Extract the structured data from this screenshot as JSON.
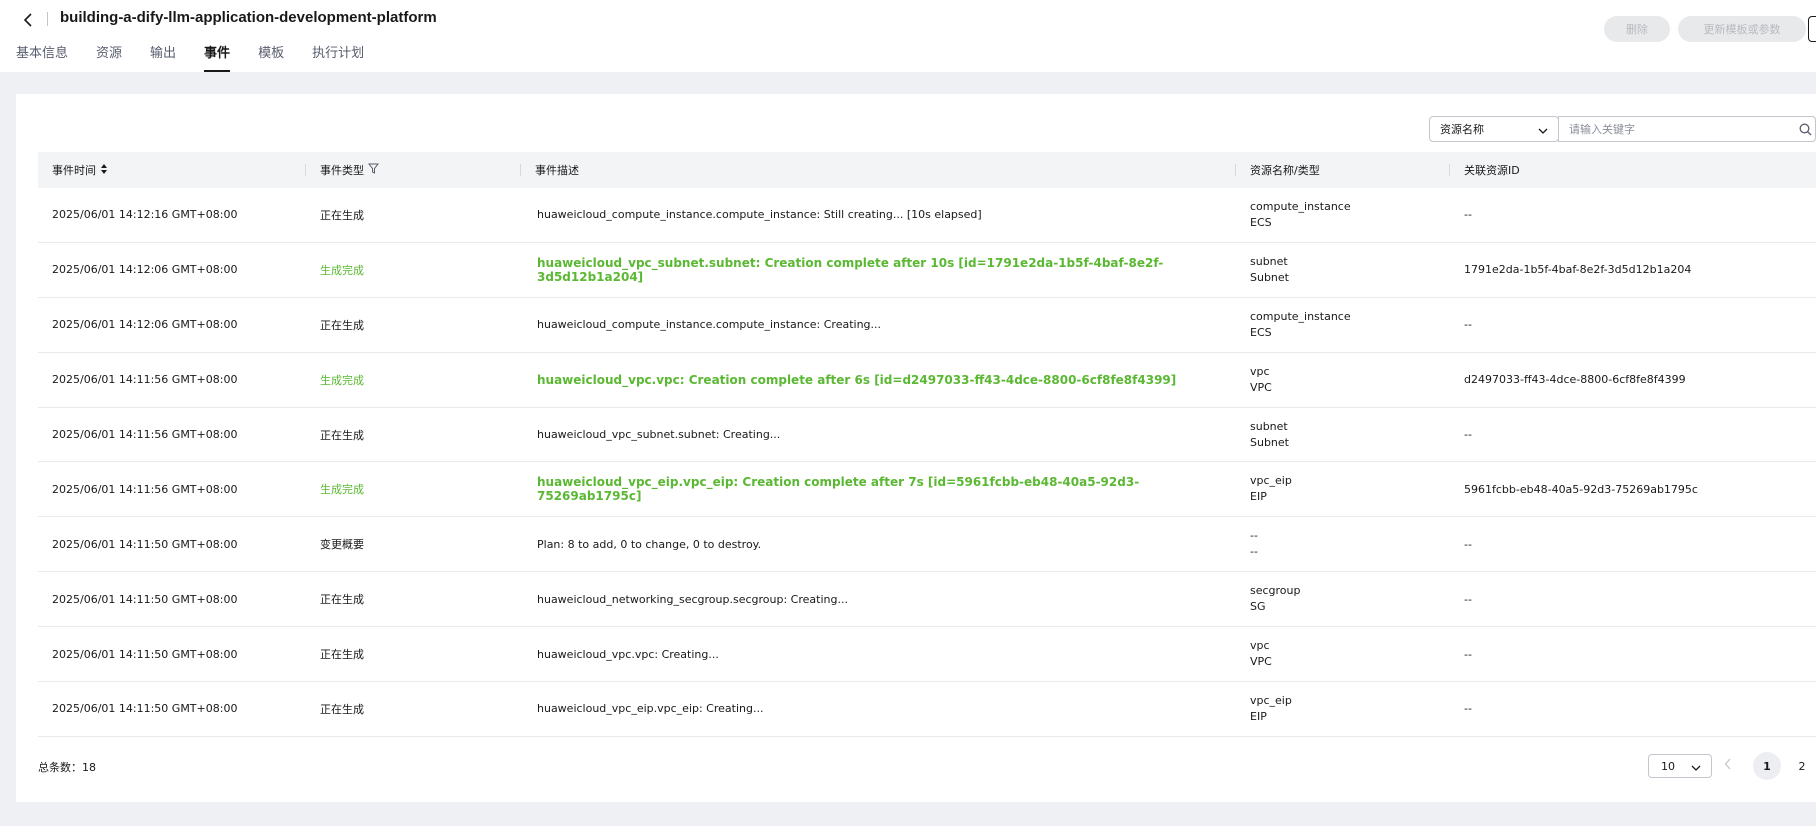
{
  "header": {
    "title": "building-a-dify-llm-application-development-platform",
    "delete_label": "删除",
    "update_label": "更新模板或参数"
  },
  "tabs": [
    {
      "label": "基本信息"
    },
    {
      "label": "资源"
    },
    {
      "label": "输出"
    },
    {
      "label": "事件"
    },
    {
      "label": "模板"
    },
    {
      "label": "执行计划"
    }
  ],
  "filter": {
    "select_value": "资源名称",
    "search_placeholder": "请输入关键字"
  },
  "table": {
    "headers": [
      "事件时间",
      "事件类型",
      "事件描述",
      "资源名称/类型",
      "关联资源ID"
    ],
    "rows": [
      {
        "time": "2025/06/01 14:12:16 GMT+08:00",
        "type": "正在生成",
        "desc": "huaweicloud_compute_instance.compute_instance: Still creating... [10s elapsed]",
        "res_name": "compute_instance",
        "res_type": "ECS",
        "res_id": "--",
        "status": "creating"
      },
      {
        "time": "2025/06/01 14:12:06 GMT+08:00",
        "type": "生成完成",
        "desc": "huaweicloud_vpc_subnet.subnet: Creation complete after 10s [id=1791e2da-1b5f-4baf-8e2f-3d5d12b1a204]",
        "res_name": "subnet",
        "res_type": "Subnet",
        "res_id": "1791e2da-1b5f-4baf-8e2f-3d5d12b1a204",
        "status": "success"
      },
      {
        "time": "2025/06/01 14:12:06 GMT+08:00",
        "type": "正在生成",
        "desc": "huaweicloud_compute_instance.compute_instance: Creating...",
        "res_name": "compute_instance",
        "res_type": "ECS",
        "res_id": "--",
        "status": "creating"
      },
      {
        "time": "2025/06/01 14:11:56 GMT+08:00",
        "type": "生成完成",
        "desc": "huaweicloud_vpc.vpc: Creation complete after 6s [id=d2497033-ff43-4dce-8800-6cf8fe8f4399]",
        "res_name": "vpc",
        "res_type": "VPC",
        "res_id": "d2497033-ff43-4dce-8800-6cf8fe8f4399",
        "status": "success"
      },
      {
        "time": "2025/06/01 14:11:56 GMT+08:00",
        "type": "正在生成",
        "desc": "huaweicloud_vpc_subnet.subnet: Creating...",
        "res_name": "subnet",
        "res_type": "Subnet",
        "res_id": "--",
        "status": "creating"
      },
      {
        "time": "2025/06/01 14:11:56 GMT+08:00",
        "type": "生成完成",
        "desc": "huaweicloud_vpc_eip.vpc_eip: Creation complete after 7s [id=5961fcbb-eb48-40a5-92d3-75269ab1795c]",
        "res_name": "vpc_eip",
        "res_type": "EIP",
        "res_id": "5961fcbb-eb48-40a5-92d3-75269ab1795c",
        "status": "success"
      },
      {
        "time": "2025/06/01 14:11:50 GMT+08:00",
        "type": "变更概要",
        "desc": "Plan: 8 to add, 0 to change, 0 to destroy.",
        "res_name": "--",
        "res_type": "--",
        "res_id": "--",
        "status": "plan"
      },
      {
        "time": "2025/06/01 14:11:50 GMT+08:00",
        "type": "正在生成",
        "desc": "huaweicloud_networking_secgroup.secgroup: Creating...",
        "res_name": "secgroup",
        "res_type": "SG",
        "res_id": "--",
        "status": "creating"
      },
      {
        "time": "2025/06/01 14:11:50 GMT+08:00",
        "type": "正在生成",
        "desc": "huaweicloud_vpc.vpc: Creating...",
        "res_name": "vpc",
        "res_type": "VPC",
        "res_id": "--",
        "status": "creating"
      },
      {
        "time": "2025/06/01 14:11:50 GMT+08:00",
        "type": "正在生成",
        "desc": "huaweicloud_vpc_eip.vpc_eip: Creating...",
        "res_name": "vpc_eip",
        "res_type": "EIP",
        "res_id": "--",
        "status": "creating"
      }
    ]
  },
  "footer": {
    "total_label": "总条数：",
    "total_count": "18",
    "page_size": "10",
    "pages": [
      "1",
      "2"
    ]
  },
  "colors": {
    "success": "#5bb833",
    "text": "#191919",
    "header_bg": "#f3f4f6"
  }
}
